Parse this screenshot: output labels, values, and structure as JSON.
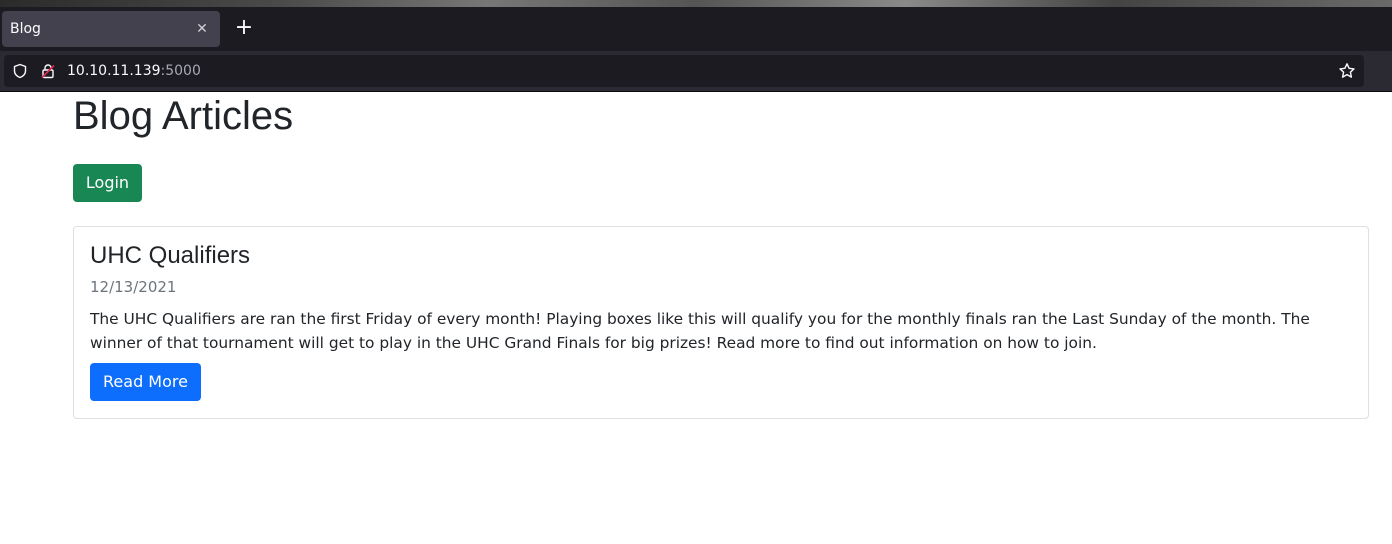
{
  "browser": {
    "tab_title": "Blog",
    "tab_close_icon": "close-icon",
    "new_tab_icon": "plus-icon",
    "url_host": "10.10.11.139",
    "url_port": ":5000"
  },
  "page": {
    "title": "Blog Articles",
    "login_label": "Login"
  },
  "articles": [
    {
      "title": "UHC Qualifiers",
      "date": "12/13/2021",
      "body": "The UHC Qualifiers are ran the first Friday of every month! Playing boxes like this will qualify you for the monthly finals ran the Last Sunday of the month. The winner of that tournament will get to play in the UHC Grand Finals for big prizes! Read more to find out information on how to join.",
      "button_label": "Read More"
    }
  ],
  "colors": {
    "success": "#198754",
    "primary": "#0d6efd",
    "muted": "#6c757d"
  }
}
